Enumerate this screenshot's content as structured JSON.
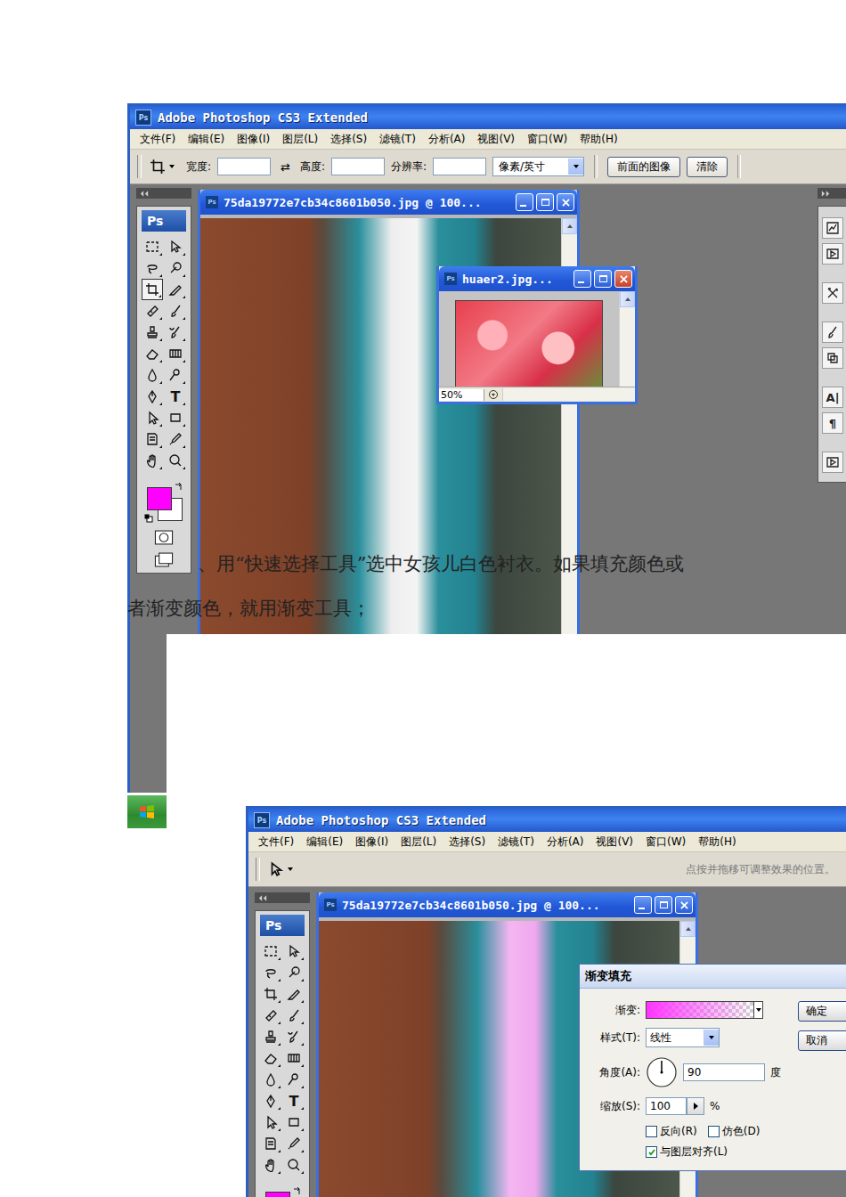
{
  "document_text": "、用“快速选择工具”选中女孩儿白色衬衣。如果填充颜色或者渐变颜色，就用渐变工具；",
  "crop_screenshot": {
    "app_title": "Adobe Photoshop CS3 Extended",
    "app_badge": "Ps",
    "menu": [
      "文件(F)",
      "编辑(E)",
      "图像(I)",
      "图层(L)",
      "选择(S)",
      "滤镜(T)",
      "分析(A)",
      "视图(V)",
      "窗口(W)",
      "帮助(H)"
    ],
    "options_bar": {
      "fields": [
        {
          "label": "宽度:"
        },
        {
          "label": "高度:"
        },
        {
          "label": "分辨率:"
        }
      ],
      "swap_glyph": "⇄",
      "unit": "像素/英寸",
      "buttons": [
        "前面的图像",
        "清除"
      ]
    },
    "toolbox": {
      "badge": "Ps",
      "foreground": "#ff00ff",
      "background": "#ffffff",
      "tools": [
        {
          "kind": "icon",
          "selected": false
        },
        {
          "kind": "icon",
          "selected": false
        },
        {
          "kind": "icon",
          "selected": false
        },
        {
          "kind": "icon",
          "selected": false
        },
        {
          "kind": "icon",
          "selected": true
        },
        {
          "kind": "icon",
          "selected": false
        },
        {
          "kind": "icon",
          "selected": false
        },
        {
          "kind": "icon",
          "selected": false
        },
        {
          "kind": "icon",
          "selected": false
        },
        {
          "kind": "icon",
          "selected": false
        },
        {
          "kind": "icon",
          "selected": false
        },
        {
          "kind": "icon",
          "selected": false
        },
        {
          "kind": "icon",
          "selected": false
        },
        {
          "kind": "icon",
          "selected": false
        },
        {
          "kind": "icon",
          "selected": false
        },
        {
          "kind": "glyph",
          "glyph": "T",
          "selected": false
        },
        {
          "kind": "icon",
          "selected": false
        },
        {
          "kind": "icon",
          "selected": false
        },
        {
          "kind": "icon",
          "selected": false
        },
        {
          "kind": "icon",
          "selected": false
        },
        {
          "kind": "icon",
          "selected": false
        },
        {
          "kind": "icon",
          "selected": false
        }
      ]
    },
    "main_document": {
      "title": "75da19772e7cb34c8601b050.jpg @ 100..."
    },
    "second_document": {
      "title": "huaer2.jpg...",
      "zoom": "50%"
    },
    "dock_groups": [
      [
        {
          "kind": "icon"
        },
        {
          "kind": "icon"
        }
      ],
      [
        {
          "kind": "icon"
        }
      ],
      [
        {
          "kind": "icon"
        },
        {
          "kind": "icon"
        }
      ],
      [
        {
          "kind": "glyph",
          "glyph": "A|"
        },
        {
          "kind": "glyph",
          "glyph": "¶"
        }
      ],
      [
        {
          "kind": "icon"
        }
      ]
    ]
  },
  "gradient_screenshot": {
    "app_title": "Adobe Photoshop CS3 Extended",
    "app_badge": "Ps",
    "menu": [
      "文件(F)",
      "编辑(E)",
      "图像(I)",
      "图层(L)",
      "选择(S)",
      "滤镜(T)",
      "分析(A)",
      "视图(V)",
      "窗口(W)",
      "帮助(H)"
    ],
    "options_bar": {
      "hint": "点按并拖移可调整效果的位置。"
    },
    "toolbox": {
      "badge": "Ps",
      "foreground": "#ff00ff",
      "background": "#ffffff",
      "tools": [
        {
          "kind": "icon",
          "selected": false
        },
        {
          "kind": "icon",
          "selected": false
        },
        {
          "kind": "icon",
          "selected": false
        },
        {
          "kind": "icon",
          "selected": false
        },
        {
          "kind": "icon",
          "selected": false
        },
        {
          "kind": "icon",
          "selected": false
        },
        {
          "kind": "icon",
          "selected": false
        },
        {
          "kind": "icon",
          "selected": false
        },
        {
          "kind": "icon",
          "selected": false
        },
        {
          "kind": "icon",
          "selected": false
        },
        {
          "kind": "icon",
          "selected": false
        },
        {
          "kind": "icon",
          "selected": false
        },
        {
          "kind": "icon",
          "selected": false
        },
        {
          "kind": "icon",
          "selected": false
        },
        {
          "kind": "icon",
          "selected": false
        },
        {
          "kind": "glyph",
          "glyph": "T",
          "selected": false
        },
        {
          "kind": "icon",
          "selected": false
        },
        {
          "kind": "icon",
          "selected": false
        },
        {
          "kind": "icon",
          "selected": false
        },
        {
          "kind": "icon",
          "selected": false
        },
        {
          "kind": "icon",
          "selected": false
        },
        {
          "kind": "icon",
          "selected": false
        }
      ]
    },
    "main_document": {
      "title": "75da19772e7cb34c8601b050.jpg @ 100..."
    },
    "dialog": {
      "title": "渐变填充",
      "gradient_label": "渐变:",
      "gradient_color": "#ff33ff",
      "style_label": "样式(T):",
      "style_value": "线性",
      "angle_label": "角度(A):",
      "angle_value": "90",
      "angle_unit": "度",
      "scale_label": "缩放(S):",
      "scale_value": "100",
      "scale_unit": "%",
      "checkboxes": [
        {
          "label": "反向(R)",
          "checked": false
        },
        {
          "label": "仿色(D)",
          "checked": false
        },
        {
          "label": "与图层对齐(L)",
          "checked": true
        }
      ],
      "buttons": [
        "确定",
        "取消"
      ]
    }
  }
}
